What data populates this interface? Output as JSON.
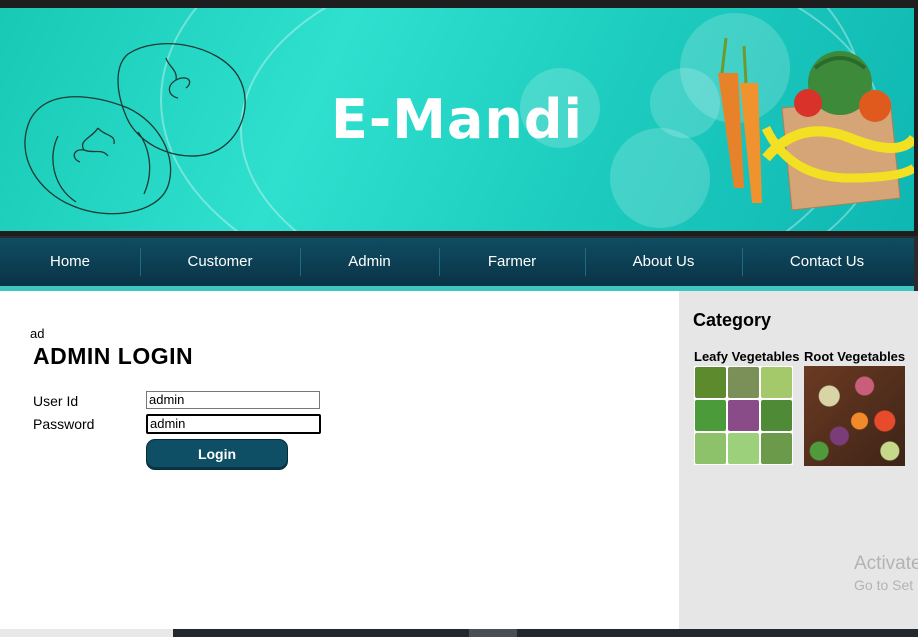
{
  "header": {
    "title": "E-Mandi"
  },
  "nav": {
    "items": [
      {
        "label": "Home"
      },
      {
        "label": "Customer"
      },
      {
        "label": "Admin"
      },
      {
        "label": "Farmer"
      },
      {
        "label": "About Us"
      },
      {
        "label": "Contact Us"
      }
    ]
  },
  "main": {
    "stray_text": "ad",
    "title": "ADMIN LOGIN",
    "userid_label": "User Id",
    "userid_value": "admin",
    "password_label": "Password",
    "password_value": "admin",
    "login_label": "Login"
  },
  "sidebar": {
    "title": "Category",
    "categories": [
      {
        "label": "Leafy Vegetables"
      },
      {
        "label": "Root Vegetables"
      }
    ]
  },
  "watermark": {
    "line1": "Activate",
    "line2": "Go to Set"
  },
  "colors": {
    "nav_bg": "#0f4d63",
    "accent_teal": "#3fc6c0",
    "button_bg": "#0e4f66"
  }
}
